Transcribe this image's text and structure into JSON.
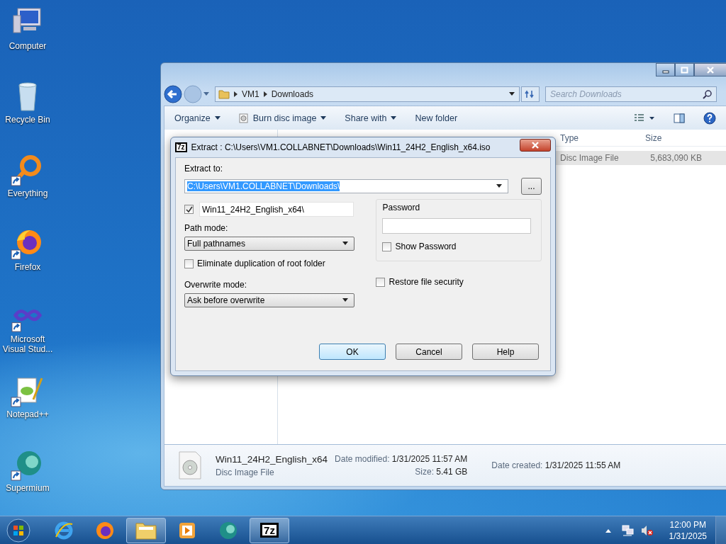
{
  "desktop_icons": [
    {
      "kind": "computer",
      "label": "Computer",
      "shortcut": false
    },
    {
      "kind": "recycle",
      "label": "Recycle Bin",
      "shortcut": false
    },
    {
      "kind": "ring",
      "label": "Everything",
      "shortcut": true
    },
    {
      "kind": "firefox",
      "label": "Firefox",
      "shortcut": true
    },
    {
      "kind": "infinity",
      "label": "Microsoft Visual Stud...",
      "shortcut": true
    },
    {
      "kind": "notepad",
      "label": "Notepad++",
      "shortcut": true
    },
    {
      "kind": "supermium",
      "label": "Supermium",
      "shortcut": true
    }
  ],
  "explorer": {
    "breadcrumb": [
      "VM1",
      "Downloads"
    ],
    "search": {
      "placeholder": "Search Downloads"
    },
    "toolbar": [
      {
        "label": "Organize",
        "menu": true,
        "icon": false
      },
      {
        "label": "Burn disc image",
        "menu": true,
        "icon": true
      },
      {
        "label": "Share with",
        "menu": true,
        "icon": false
      },
      {
        "label": "New folder",
        "menu": false,
        "icon": false
      }
    ],
    "columns": [
      "Type",
      "Size"
    ],
    "rows": [
      {
        "type": "Disc Image File",
        "size": "5,683,090 KB",
        "selected": true
      }
    ],
    "details": {
      "name": "Win11_24H2_English_x64",
      "type": "Disc Image File",
      "modified_label": "Date modified:",
      "modified": "1/31/2025 11:57 AM",
      "size_label": "Size:",
      "size": "5.41 GB",
      "created_label": "Date created:",
      "created": "1/31/2025 11:55 AM"
    }
  },
  "dialog": {
    "logo": "7z",
    "title": "Extract : C:\\Users\\VM1.COLLABNET\\Downloads\\Win11_24H2_English_x64.iso",
    "extract_to_label": "Extract to:",
    "extract_to": "C:\\Users\\VM1.COLLABNET\\Downloads\\",
    "browse_label": "...",
    "folder": {
      "checked": true,
      "value": "Win11_24H2_English_x64\\"
    },
    "path_mode_label": "Path mode:",
    "path_mode": "Full pathnames",
    "eliminate": {
      "label": "Eliminate duplication of root folder",
      "checked": false
    },
    "overwrite_label": "Overwrite mode:",
    "overwrite": "Ask before overwrite",
    "password_label": "Password",
    "show_password": {
      "label": "Show Password",
      "checked": false
    },
    "restore_security": {
      "label": "Restore file security",
      "checked": false
    },
    "buttons": [
      {
        "label": "OK",
        "default": true
      },
      {
        "label": "Cancel",
        "default": false
      },
      {
        "label": "Help",
        "default": false
      }
    ]
  },
  "taskbar": {
    "apps": [
      {
        "kind": "ie",
        "active": false
      },
      {
        "kind": "firefox",
        "active": false
      },
      {
        "kind": "explorer",
        "active": true
      },
      {
        "kind": "media",
        "active": false
      },
      {
        "kind": "supermium",
        "active": false
      },
      {
        "kind": "sevenzip",
        "active": true,
        "label": "7z"
      }
    ],
    "time": "12:00 PM",
    "date": "1/31/2025"
  }
}
